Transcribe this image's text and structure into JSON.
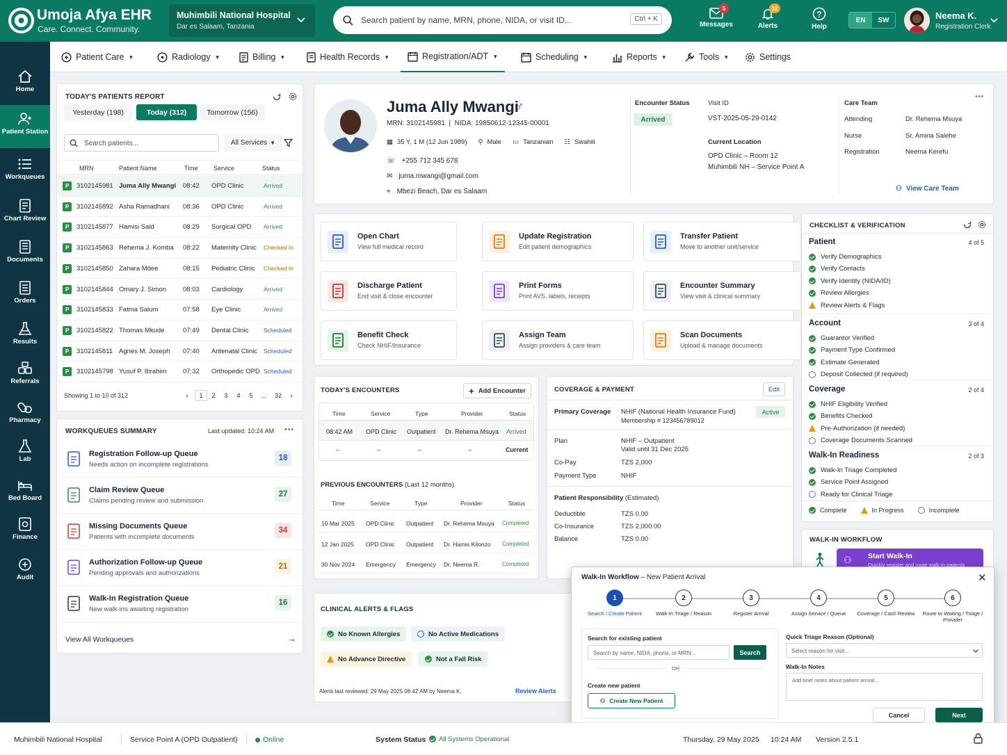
{
  "header": {
    "app_title": "Umoja Afya EHR",
    "tagline": "Care. Connect. Community.",
    "hospital_name": "Muhimbili National Hospital",
    "hospital_location": "Dar es Salaam, Tanzania",
    "search_placeholder": "Search patient by name, MRN, phone, NIDA, or visit ID...",
    "search_shortcut": "Ctrl + K",
    "messages_label": "Messages",
    "messages_count": "5",
    "alerts_label": "Alerts",
    "alerts_count": "12",
    "help_label": "Help",
    "lang_en": "EN",
    "lang_sw": "SW",
    "user_name": "Neema K.",
    "user_role": "Registration Clerk"
  },
  "sidenav": [
    "Home",
    "Patient Station",
    "Workqueues",
    "Chart Review",
    "Documents",
    "Orders",
    "Results",
    "Referrals",
    "Pharmacy",
    "Lab",
    "Bed Board",
    "Finance",
    "Audit"
  ],
  "menu": [
    "Patient Care",
    "Radiology",
    "Billing",
    "Health Records",
    "Registration/ADT",
    "Scheduling",
    "Reports",
    "Tools",
    "Settings"
  ],
  "report": {
    "title": "TODAY'S PATIENTS REPORT",
    "tabs": [
      "Yesterday (198)",
      "Today (312)",
      "Tomorrow (156)"
    ],
    "search_placeholder": "Search patients...",
    "filter": "All Services",
    "columns": [
      "MRN",
      "Patient Name",
      "Time",
      "Service",
      "Status"
    ],
    "rows": [
      {
        "mrn": "3102145981",
        "name": "Juma Ally Mwangi",
        "time": "08:42",
        "service": "OPD Clinic",
        "status": "Arrived"
      },
      {
        "mrn": "3102145892",
        "name": "Asha Ramadhani",
        "time": "08:36",
        "service": "OPD Clinic",
        "status": "Arrived"
      },
      {
        "mrn": "3102145877",
        "name": "Hamisi Said",
        "time": "08:29",
        "service": "Surgical OPD",
        "status": "Arrived"
      },
      {
        "mrn": "3102145863",
        "name": "Rehema J. Komba",
        "time": "08:22",
        "service": "Maternity Clinic",
        "status": "Checked In"
      },
      {
        "mrn": "3102145850",
        "name": "Zahara Mdee",
        "time": "08:15",
        "service": "Pediatric Clinic",
        "status": "Checked In"
      },
      {
        "mrn": "3102145844",
        "name": "Omary J. Simon",
        "time": "08:03",
        "service": "Cardiology",
        "status": "Arrived"
      },
      {
        "mrn": "3102145833",
        "name": "Fatma Salum",
        "time": "07:58",
        "service": "Eye Clinic",
        "status": "Arrived"
      },
      {
        "mrn": "3102145822",
        "name": "Thomas Mkude",
        "time": "07:49",
        "service": "Dental Clinic",
        "status": "Scheduled"
      },
      {
        "mrn": "3102145811",
        "name": "Agnes M. Joseph",
        "time": "07:40",
        "service": "Antenatal Clinic",
        "status": "Scheduled"
      },
      {
        "mrn": "3102145798",
        "name": "Yusuf P. Ibrahim",
        "time": "07:32",
        "service": "Orthopedic OPD",
        "status": "Scheduled"
      }
    ],
    "row_badge": "P",
    "showing": "Showing 1 to 10 of 312",
    "pages": [
      "1",
      "2",
      "3",
      "4",
      "5",
      "...",
      "32"
    ]
  },
  "workqueues": {
    "title": "WORKQUEUES SUMMARY",
    "updated": "Last updated: 10:24 AM",
    "items": [
      {
        "title": "Registration Follow-up Queue",
        "sub": "Needs action on incomplete registrations",
        "count": "18"
      },
      {
        "title": "Claim Review Queue",
        "sub": "Claims pending review and submission",
        "count": "27"
      },
      {
        "title": "Missing Documents Queue",
        "sub": "Patients with incomplete documents",
        "count": "34"
      },
      {
        "title": "Authorization Follow-up Queue",
        "sub": "Pending approvals and authorizations",
        "count": "21"
      },
      {
        "title": "Walk-In Registration Queue",
        "sub": "New walk-ins awaiting registration",
        "count": "16"
      }
    ],
    "view_all": "View All Workqueues"
  },
  "patient": {
    "name": "Juma Ally Mwangi",
    "ids": "MRN: 3102145981  |  NIDA: 19850612-12345-00001",
    "age": "35 Y, 1 M (12 Jun 1989)",
    "sex": "Male",
    "nationality": "Tanzanian",
    "language": "Swahili",
    "phone": "+255 712 345 678",
    "email": "juma.mwangi@gmail.com",
    "address": "Mbezi Beach, Dar es Salaam",
    "encounter_status_label": "Encounter Status",
    "encounter_status": "Arrived",
    "visit_id_label": "Visit ID",
    "visit_id": "VST-2025-05-29-0142",
    "location_label": "Current Location",
    "location_1": "OPD Clinic – Room 12",
    "location_2": "Muhimbili NH – Service Point A",
    "care_team_label": "Care Team",
    "care_team": [
      {
        "role": "Attending",
        "name": "Dr. Rehema Msuya"
      },
      {
        "role": "Nurse",
        "name": "Sr. Amina Salehe"
      },
      {
        "role": "Registration",
        "name": "Neema Kerefu"
      }
    ],
    "view_care_team": "View Care Team"
  },
  "actions": [
    {
      "title": "Open Chart",
      "sub": "View full medical record",
      "icon": "chart-doc-icon"
    },
    {
      "title": "Update Registration",
      "sub": "Edit patient demographics",
      "icon": "edit-form-icon"
    },
    {
      "title": "Transfer Patient",
      "sub": "Move to another unit/service",
      "icon": "transfer-icon"
    },
    {
      "title": "Discharge Patient",
      "sub": "End visit & close encounter",
      "icon": "discharge-icon"
    },
    {
      "title": "Print Forms",
      "sub": "Print AVS, labels, receipts",
      "icon": "printer-icon"
    },
    {
      "title": "Encounter Summary",
      "sub": "View visit & clinical summary",
      "icon": "summary-icon"
    },
    {
      "title": "Benefit Check",
      "sub": "Check NHIF/Insurance",
      "icon": "shield-check-icon"
    },
    {
      "title": "Assign Team",
      "sub": "Assign providers & care team",
      "icon": "team-icon"
    },
    {
      "title": "Scan Documents",
      "sub": "Upload & manage documents",
      "icon": "scan-doc-icon"
    }
  ],
  "encounters": {
    "title": "TODAY'S ENCOUNTERS",
    "add_label": "Add Encounter",
    "columns": [
      "Time",
      "Service",
      "Type",
      "Provider",
      "Status"
    ],
    "today": [
      {
        "time": "08:42 AM",
        "service": "OPD Clinic",
        "type": "Outpatient",
        "provider": "Dr. Rehema Msuya",
        "status": "Arrived"
      }
    ],
    "placeholder_row": {
      "dash": "–",
      "status": "Current"
    },
    "prev_title": "PREVIOUS ENCOUNTERS",
    "prev_sub": "(Last 12 months)",
    "previous": [
      {
        "time": "10 Mar 2025",
        "service": "OPD Clinic",
        "type": "Outpatient",
        "provider": "Dr. Rehema Msuya",
        "status": "Completed"
      },
      {
        "time": "12 Jan 2025",
        "service": "OPD Clinic",
        "type": "Outpatient",
        "provider": "Dr. Hamis Kilonzo",
        "status": "Completed"
      },
      {
        "time": "30 Nov 2024",
        "service": "Emergency",
        "type": "Emergency",
        "provider": "Dr. Neema R.",
        "status": "Completed"
      }
    ]
  },
  "coverage": {
    "title": "COVERAGE & PAYMENT",
    "edit": "Edit",
    "primary_label": "Primary Coverage",
    "primary_value": "NHIF (National Health Insurance Fund)",
    "membership": "Membership # 123456789012",
    "status": "Active",
    "plan_label": "Plan",
    "plan_value": "NHIF – Outpatient",
    "plan_valid": "Valid until 31 Dec 2025",
    "copay_label": "Co-Pay",
    "copay_value": "TZS 2,000",
    "paytype_label": "Payment Type",
    "paytype_value": "NHIF",
    "resp_title": "Patient Responsibility",
    "resp_sub": "(Estimated)",
    "deductible_label": "Deductible",
    "deductible_value": "TZS 0.00",
    "coins_label": "Co-Insurance",
    "coins_value": "TZS 2,000.00",
    "balance_label": "Balance",
    "balance_value": "TZS 0.00"
  },
  "alerts": {
    "title": "CLINICAL ALERTS & FLAGS",
    "flags": [
      "No Known Allergies",
      "No Active Medications",
      "No Advance Directive",
      "Not a Fall Risk"
    ],
    "reviewed": "Alerts last reviewed: 29 May 2025 08:42 AM by Neema K.",
    "review_link": "Review Alerts"
  },
  "checklist": {
    "title": "CHECKLIST & VERIFICATION",
    "sections": [
      {
        "name": "Patient",
        "count": "4 of 5",
        "items": [
          {
            "label": "Verify Demographics",
            "state": "ok"
          },
          {
            "label": "Verify Contacts",
            "state": "ok"
          },
          {
            "label": "Verify Identity (NIDA/ID)",
            "state": "ok"
          },
          {
            "label": "Review Allergies",
            "state": "ok"
          },
          {
            "label": "Review Alerts & Flags",
            "state": "warn"
          }
        ]
      },
      {
        "name": "Account",
        "count": "3 of 4",
        "items": [
          {
            "label": "Guarantor Verified",
            "state": "ok"
          },
          {
            "label": "Payment Type Confirmed",
            "state": "ok"
          },
          {
            "label": "Estimate Generated",
            "state": "ok"
          },
          {
            "label": "Deposit Collected (if required)",
            "state": "no"
          }
        ]
      },
      {
        "name": "Coverage",
        "count": "2 of 4",
        "items": [
          {
            "label": "NHIF Eligibility Verified",
            "state": "ok"
          },
          {
            "label": "Benefits Checked",
            "state": "ok"
          },
          {
            "label": "Pre-Authorization (if needed)",
            "state": "warn"
          },
          {
            "label": "Coverage Documents Scanned",
            "state": "no"
          }
        ]
      },
      {
        "name": "Walk-In Readiness",
        "count": "2 of 3",
        "items": [
          {
            "label": "Walk-In Triage Completed",
            "state": "ok"
          },
          {
            "label": "Service Point Assigned",
            "state": "ok"
          },
          {
            "label": "Ready for Clinical Triage",
            "state": "no"
          }
        ]
      }
    ],
    "legend": [
      "Complete",
      "In Progress",
      "Incomplete"
    ]
  },
  "walkin": {
    "title": "WALK-IN WORKFLOW",
    "start": "Start Walk-In",
    "start_sub": "Quickly register and route walk-in patients"
  },
  "modal": {
    "title": "Walk-In Workflow",
    "subtitle": "– New Patient Arrival",
    "steps": [
      "Search / Create Patient",
      "Walk-In Triage / Reason",
      "Register Arrival",
      "Assign Service / Queue",
      "Coverage / Cash Review",
      "Route to Waiting / Triage / Provider"
    ],
    "step_nums": [
      "1",
      "2",
      "3",
      "4",
      "5",
      "6"
    ],
    "search_label": "Search for existing patient",
    "search_placeholder": "Search by name, NIDA, phone, or MRN...",
    "search_btn": "Search",
    "or": "OR",
    "create_label": "Create new patient",
    "create_btn": "Create New Patient",
    "triage_label": "Quick Triage Reason (Optional)",
    "triage_placeholder": "Select reason for visit...",
    "notes_label": "Walk-In Notes",
    "notes_placeholder": "Add brief notes about patient arrival...",
    "cancel": "Cancel",
    "next": "Next"
  },
  "footer": {
    "hospital": "Muhimbili National Hospital",
    "service_point": "Service Point A (OPD Outpatient)",
    "online": "Online",
    "system_status_label": "System Status",
    "system_status": "All Systems Operational",
    "date": "Thursday, 29 May 2025",
    "time": "10:24 AM",
    "version": "Version 2.5.1"
  },
  "colors": {
    "brand": "#0b7a62",
    "nav": "#0f3443",
    "accent_purple": "#7b3fd0",
    "arrived": "#2e8b46",
    "checked_in": "#b36a00",
    "scheduled": "#1f5fbf"
  }
}
